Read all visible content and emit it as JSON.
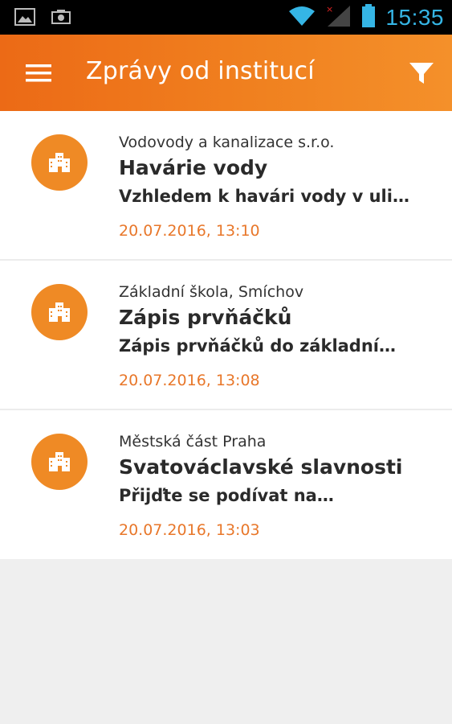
{
  "status_bar": {
    "time": "15:35",
    "icons": [
      "image-icon",
      "camera-icon",
      "wifi-icon",
      "signal-icon",
      "battery-icon"
    ]
  },
  "app_bar": {
    "title": "Zprávy od institucí",
    "menu_icon": "menu-icon",
    "filter_icon": "filter-icon"
  },
  "colors": {
    "accent": "#f0801f",
    "date": "#e8772a",
    "avatar": "#ef8a25"
  },
  "messages": [
    {
      "sender": "Vodovody a kanalizace s.r.o.",
      "subject": "Havárie vody",
      "preview": "Vzhledem k havári vody v uli…",
      "date": "20.07.2016, 13:10",
      "icon": "building-icon"
    },
    {
      "sender": "Základní škola, Smíchov",
      "subject": "Zápis prvňáčků",
      "preview": "Zápis prvňáčků do základní…",
      "date": "20.07.2016, 13:08",
      "icon": "building-icon"
    },
    {
      "sender": "Městská část Praha",
      "subject": "Svatováclavské slavnosti",
      "preview": "Přijďte se podívat na…",
      "date": "20.07.2016, 13:03",
      "icon": "building-icon"
    }
  ]
}
